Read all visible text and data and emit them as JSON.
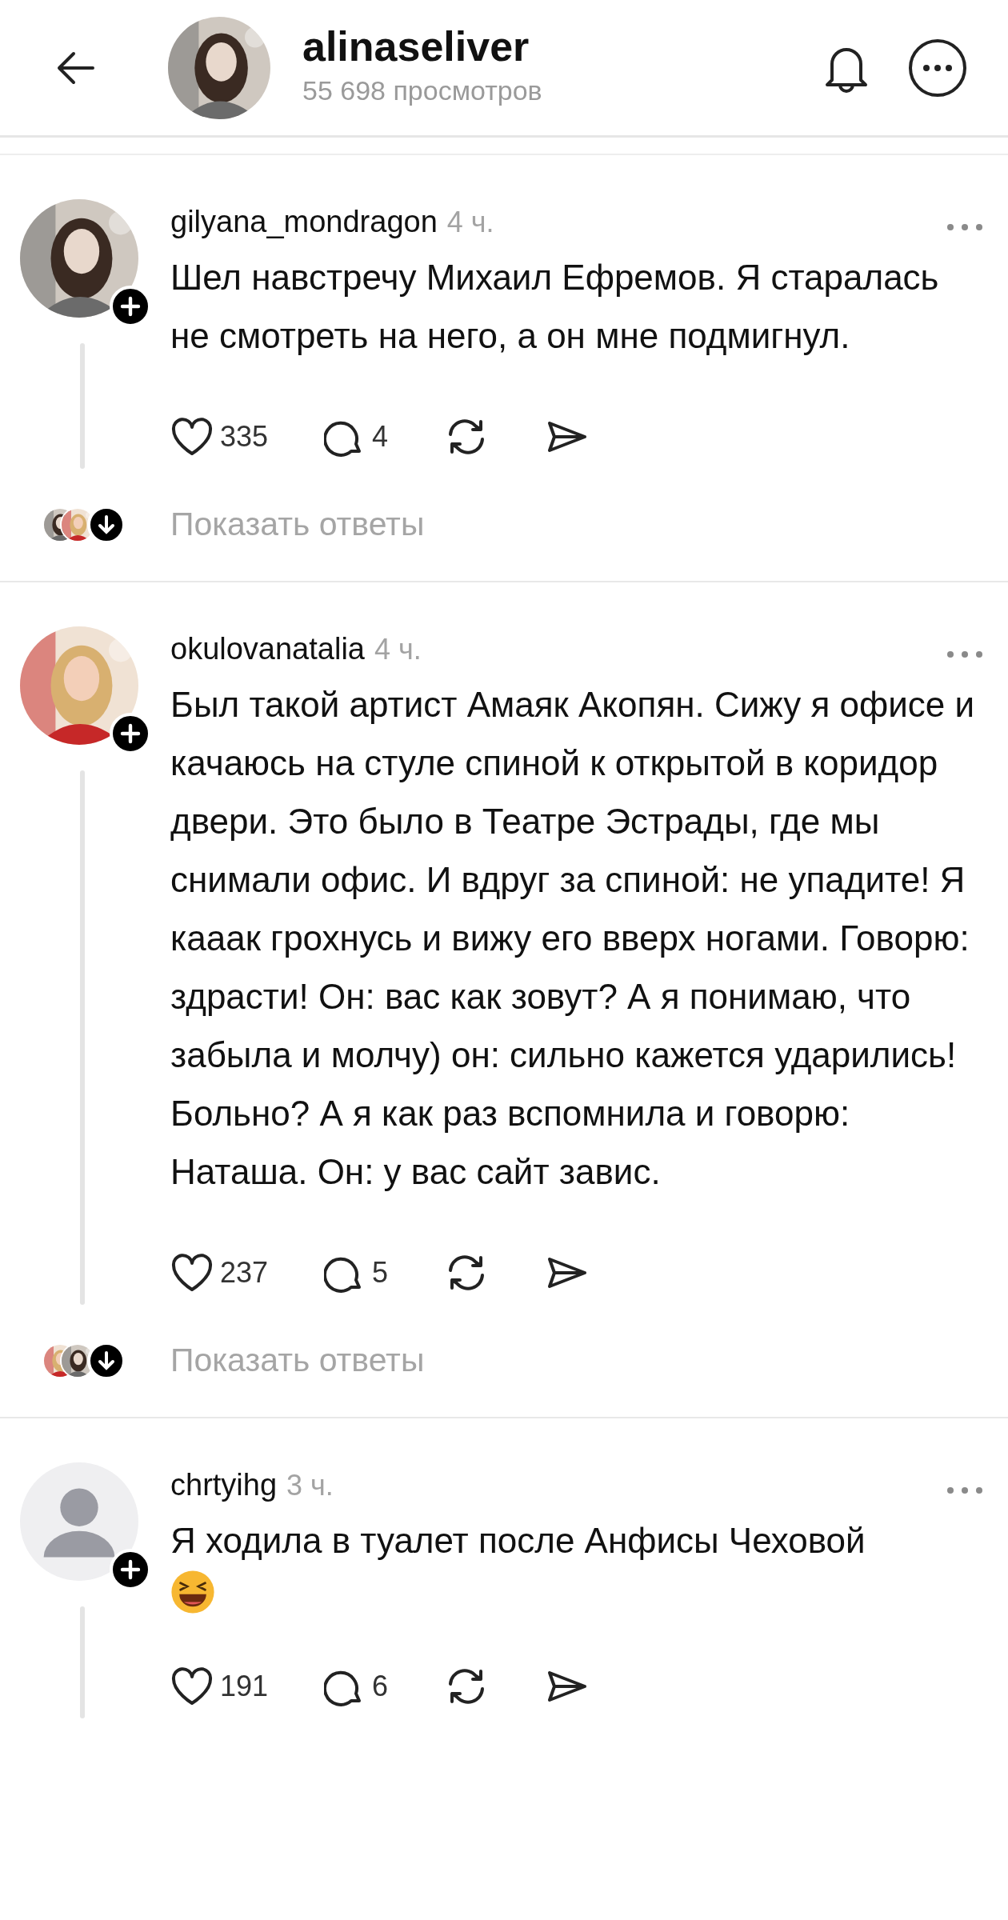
{
  "header": {
    "username": "alinaseliver",
    "views": "55 698 просмотров"
  },
  "comments": [
    {
      "username": "gilyana_mondragon",
      "time": "4 ч.",
      "text": "Шел навстречу Михаил Ефремов. Я старалась не смотреть на него, а он мне подмигнул.",
      "likes": "335",
      "replies": "4",
      "show_replies": "Показать ответы"
    },
    {
      "username": "okulovanatalia",
      "time": "4 ч.",
      "text": "Был такой артист Амаяк Акопян. Сижу я офисе и качаюсь на стуле спиной к открытой в коридор двери. Это было в Театре Эстрады, где мы снимали офис. И вдруг за спиной: не упадите! Я кааак грохнусь и вижу его вверх ногами. Говорю: здрасти! Он: вас как зовут? А я понимаю, что забыла и молчу) он: сильно кажется ударились! Больно? А я как раз вспомнила и говорю: Наташа. Он: у вас сайт завис.",
      "likes": "237",
      "replies": "5",
      "show_replies": "Показать ответы"
    },
    {
      "username": "chrtyihg",
      "time": "3 ч.",
      "avatar": {
        "kind": "silhouette"
      },
      "text": "Я ходила в туалет после Анфисы Чеховой",
      "emoji": {
        "kind": "laughing-face"
      },
      "likes": "191",
      "replies": "6"
    }
  ]
}
